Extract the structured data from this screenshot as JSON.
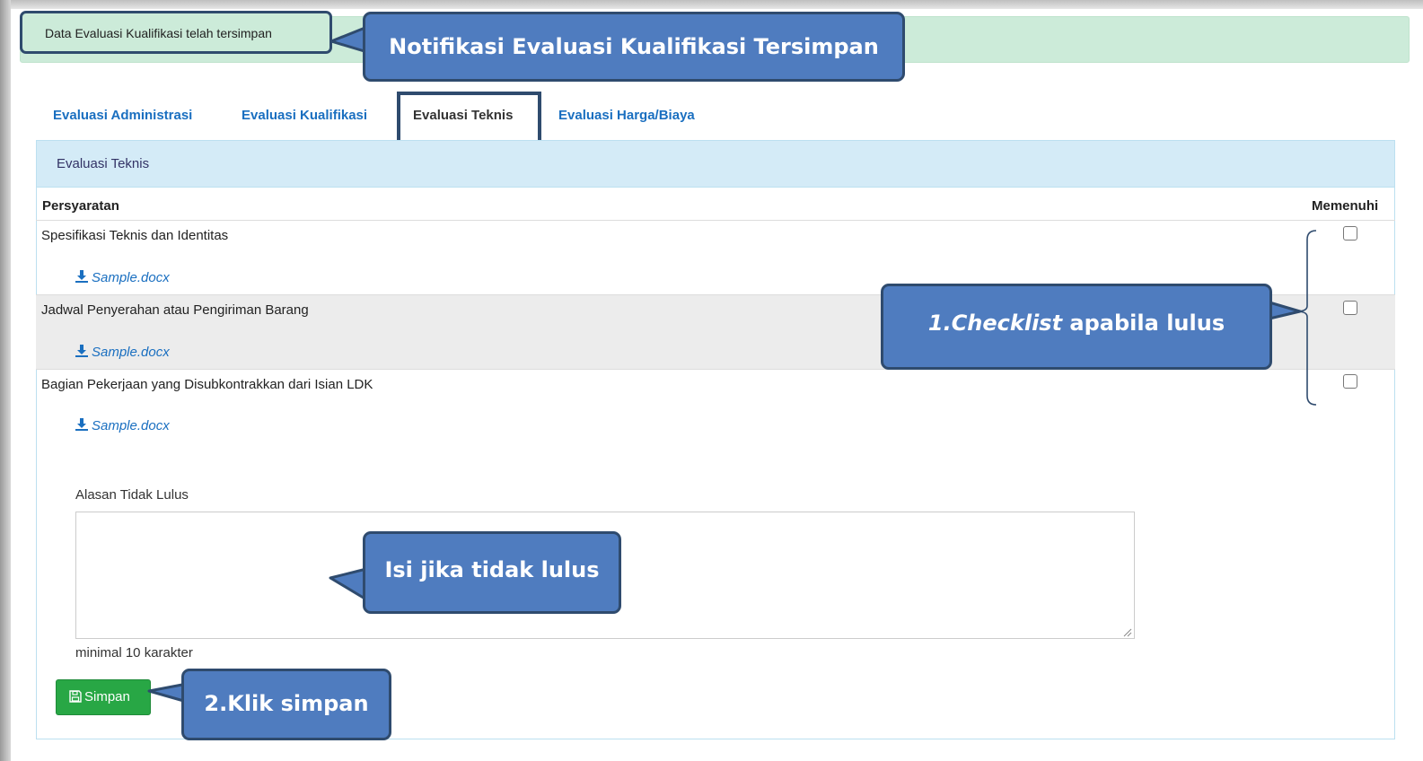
{
  "notification": {
    "text": "Data Evaluasi Kualifikasi telah tersimpan",
    "bg_color": "#ccebd9"
  },
  "tabs": [
    {
      "label": "Evaluasi Administrasi",
      "active": false
    },
    {
      "label": "Evaluasi Kualifikasi",
      "active": false
    },
    {
      "label": "Evaluasi Teknis",
      "active": true
    },
    {
      "label": "Evaluasi Harga/Biaya",
      "active": false
    }
  ],
  "panel": {
    "heading": "Evaluasi Teknis",
    "columns": {
      "requirement": "Persyaratan",
      "fulfilled": "Memenuhi"
    },
    "rows": [
      {
        "label": "Spesifikasi Teknis dan Identitas",
        "file": "Sample.docx",
        "checked": false
      },
      {
        "label": "Jadwal Penyerahan atau Pengiriman Barang",
        "file": "Sample.docx",
        "checked": false
      },
      {
        "label": "Bagian Pekerjaan yang Disubkontrakkan dari Isian LDK",
        "file": "Sample.docx",
        "checked": false
      }
    ],
    "reason_label": "Alasan Tidak Lulus",
    "reason_value": "",
    "reason_help": "minimal 10 karakter",
    "save_label": "Simpan"
  },
  "callouts": {
    "notification": "Notifikasi Evaluasi Kualifikasi Tersimpan",
    "checklist_italic": "1.Checklist",
    "checklist_rest": " apabila lulus",
    "reason": "Isi jika tidak lulus",
    "save": "2.Klik simpan"
  },
  "colors": {
    "link": "#1a6fc0",
    "panel_heading_bg": "#d4ebf7",
    "save_button": "#28a745",
    "callout_fill": "#4f7cbf",
    "callout_border": "#2f4b6e"
  },
  "icons": {
    "download": "download-icon",
    "save": "floppy-disk-icon"
  }
}
